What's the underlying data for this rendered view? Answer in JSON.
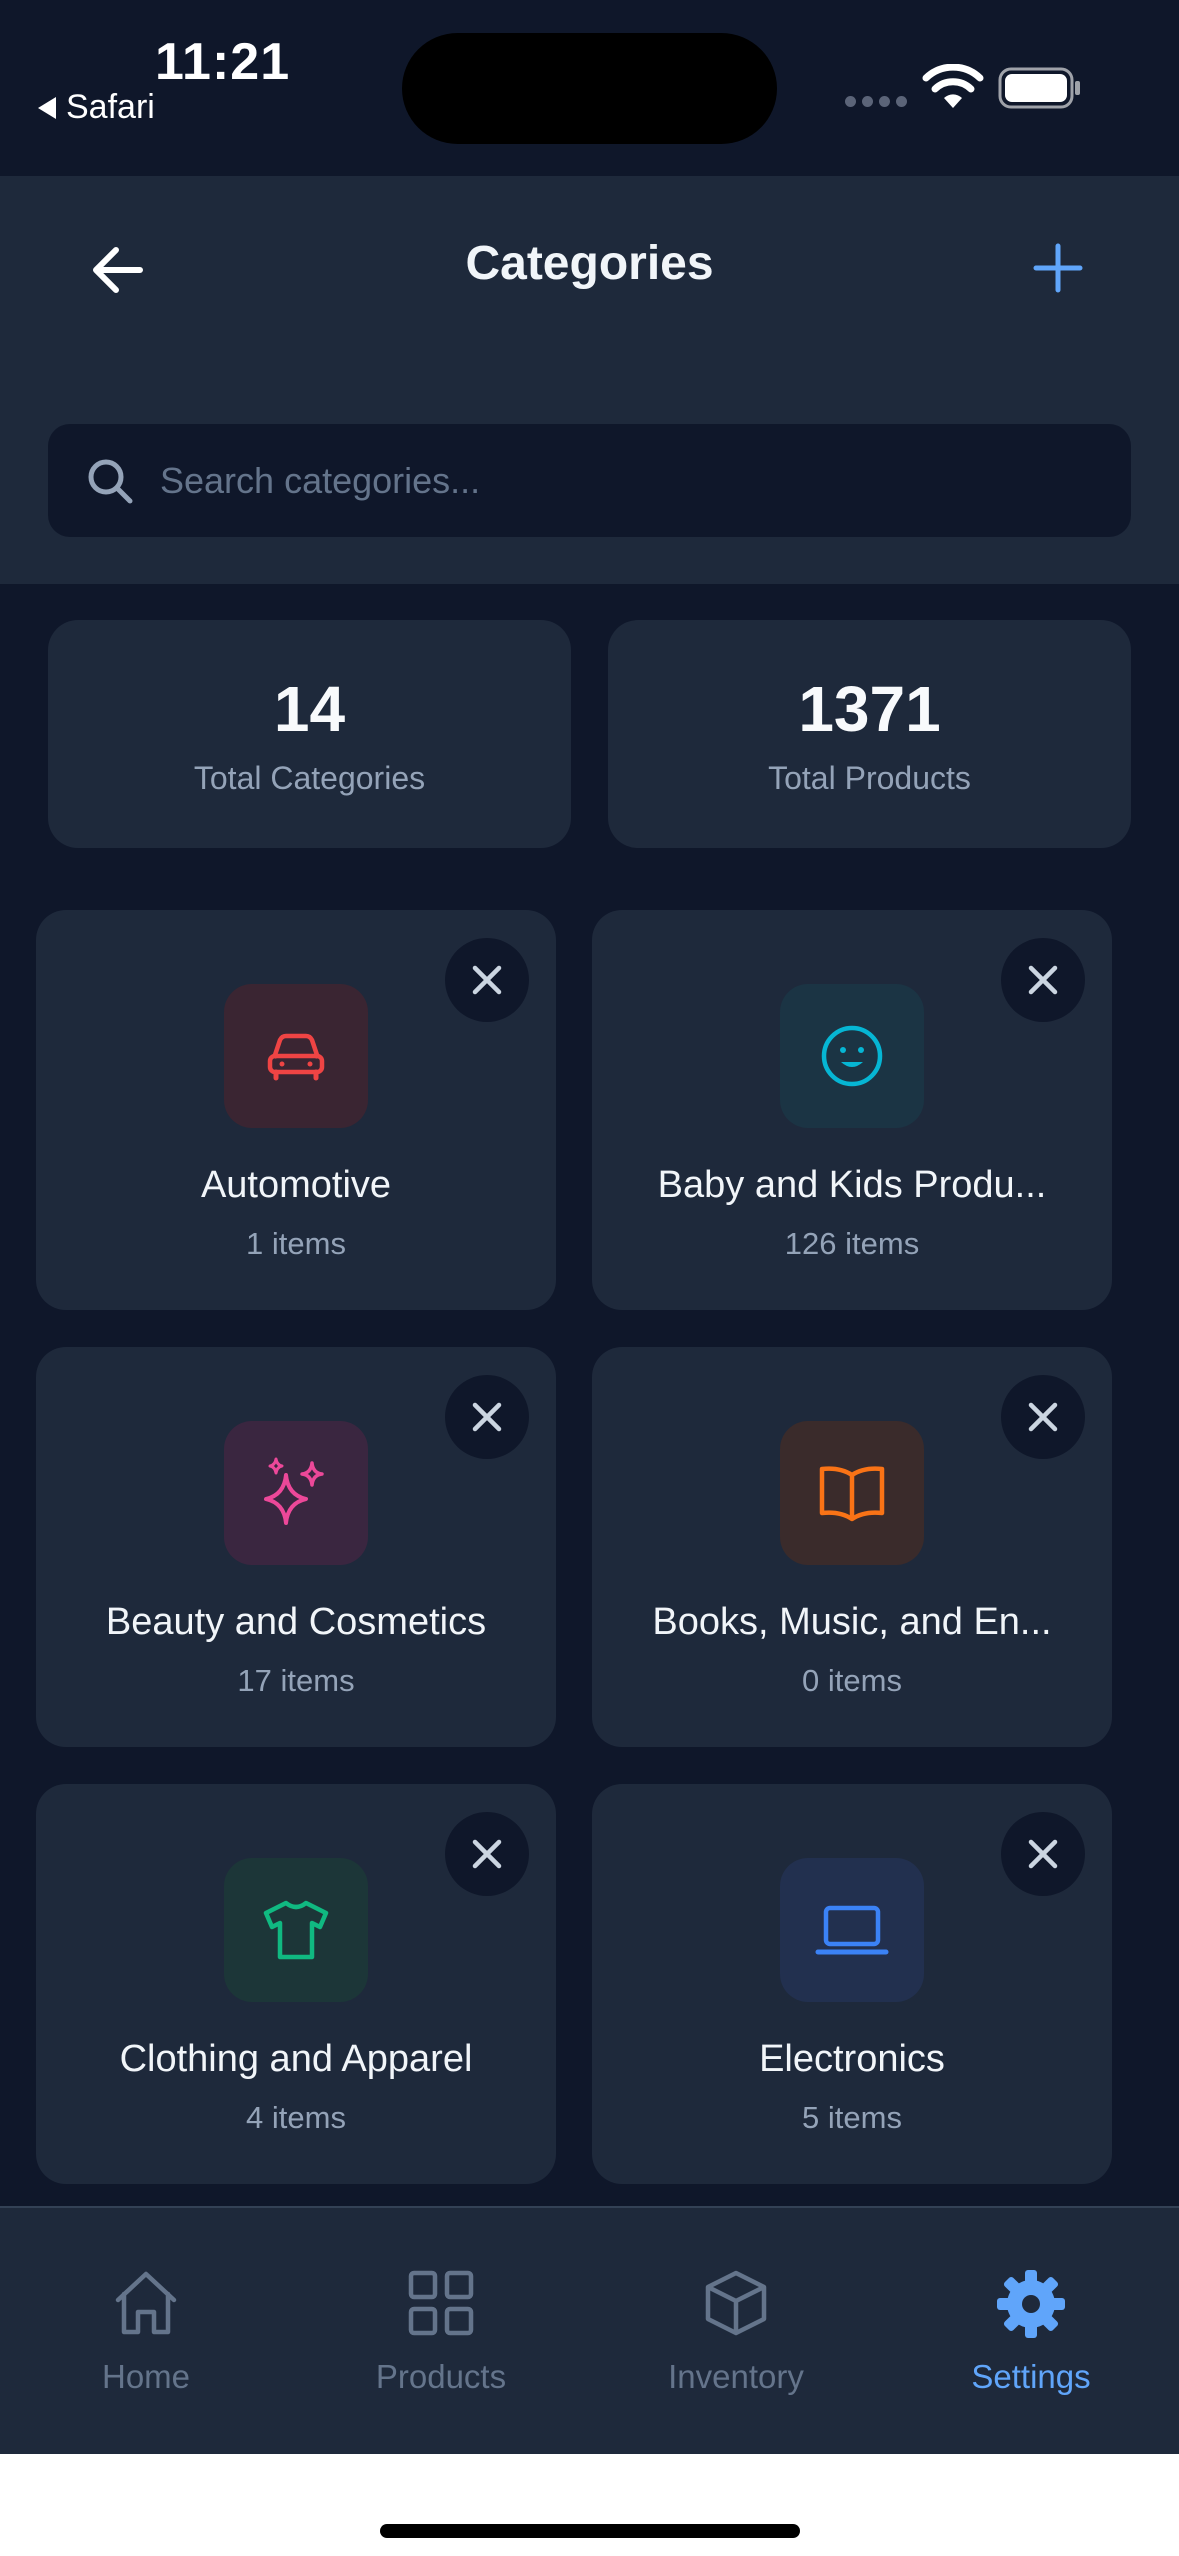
{
  "status_bar": {
    "time": "11:21",
    "back_app": "Safari"
  },
  "header": {
    "title": "Categories"
  },
  "search": {
    "placeholder": "Search categories...",
    "value": ""
  },
  "stats": [
    {
      "value": "14",
      "label": "Total Categories"
    },
    {
      "value": "1371",
      "label": "Total Products"
    }
  ],
  "categories": [
    {
      "name": "Automotive",
      "count": "1 items",
      "icon": "car-icon",
      "color": "#ef4444",
      "bg": "#3a2532"
    },
    {
      "name": "Baby and Kids Produ...",
      "count": "126 items",
      "icon": "smile-icon",
      "color": "#06b6d4",
      "bg": "#1b3444"
    },
    {
      "name": "Beauty and Cosmetics",
      "count": "17 items",
      "icon": "sparkles-icon",
      "color": "#ec4899",
      "bg": "#3a2640"
    },
    {
      "name": "Books, Music, and En...",
      "count": "0 items",
      "icon": "book-open-icon",
      "color": "#f97316",
      "bg": "#3a2b2b"
    },
    {
      "name": "Clothing and Apparel",
      "count": "4 items",
      "icon": "shirt-icon",
      "color": "#10b981",
      "bg": "#1c3638"
    },
    {
      "name": "Electronics",
      "count": "5 items",
      "icon": "laptop-icon",
      "color": "#3b82f6",
      "bg": "#22304f"
    }
  ],
  "tabs": [
    {
      "label": "Home",
      "icon": "home-icon"
    },
    {
      "label": "Products",
      "icon": "grid-icon"
    },
    {
      "label": "Inventory",
      "icon": "box-icon"
    },
    {
      "label": "Settings",
      "icon": "gear-icon",
      "active": true
    }
  ],
  "colors": {
    "background": "#0f172a",
    "surface": "#1e293b",
    "accent": "#60a5fa",
    "muted": "#94a3b8"
  }
}
